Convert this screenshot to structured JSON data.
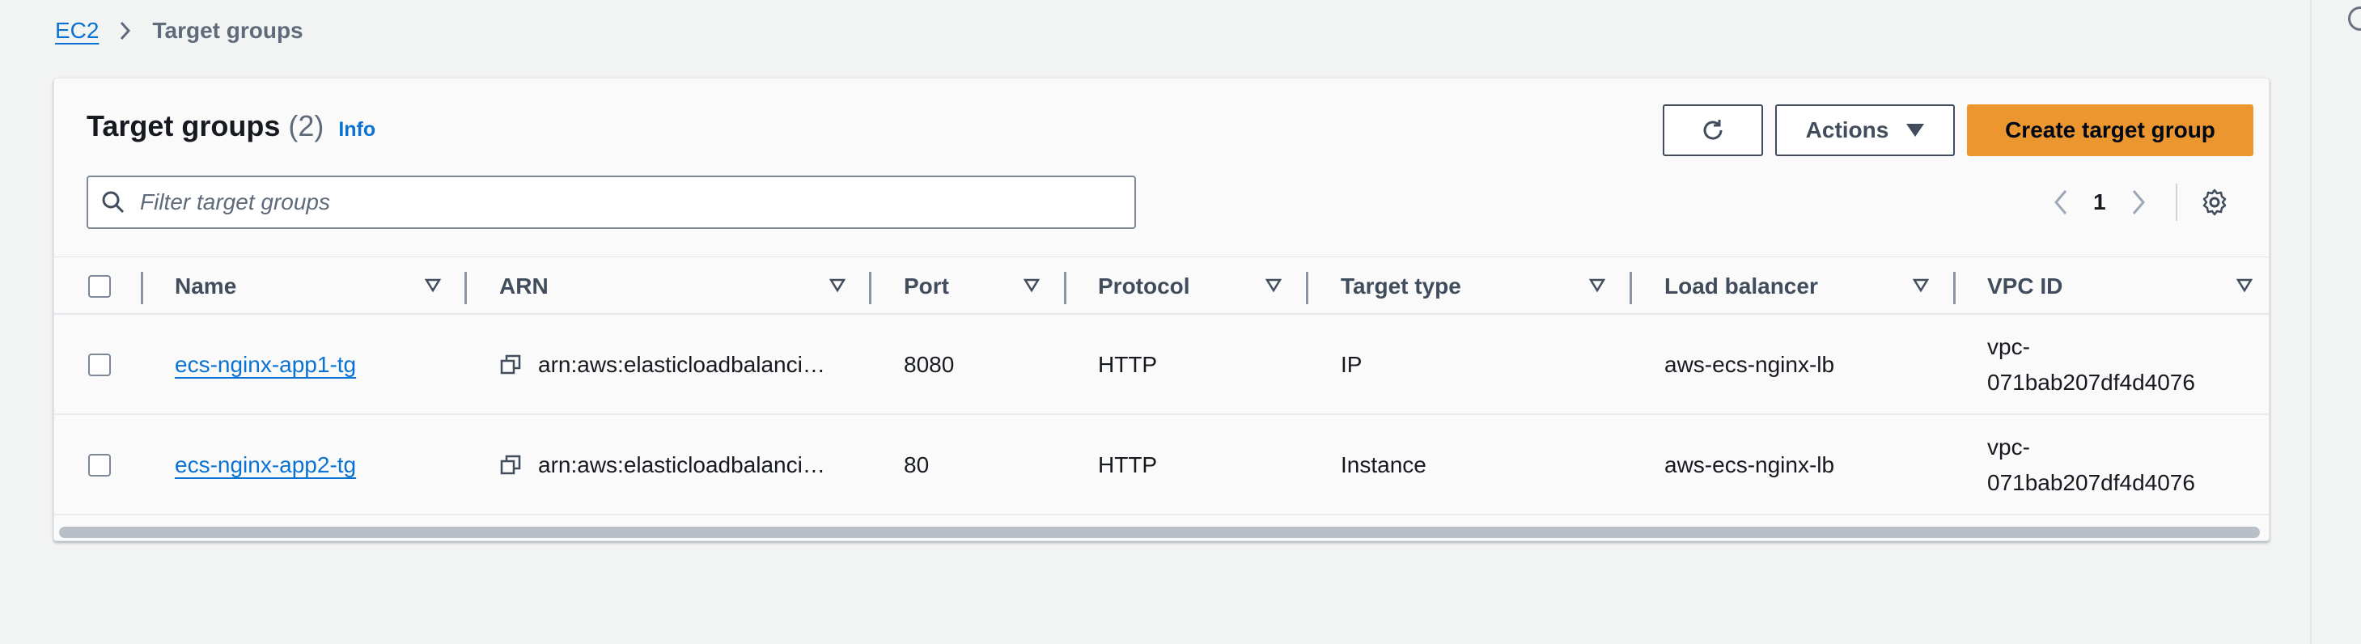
{
  "breadcrumb": {
    "root": "EC2",
    "current": "Target groups"
  },
  "panel": {
    "title": "Target groups",
    "count": "(2)",
    "info": "Info"
  },
  "toolbar": {
    "refresh_icon": "refresh-icon",
    "actions_label": "Actions",
    "create_label": "Create target group"
  },
  "filter": {
    "placeholder": "Filter target groups",
    "value": ""
  },
  "pagination": {
    "page": "1"
  },
  "columns": [
    "Name",
    "ARN",
    "Port",
    "Protocol",
    "Target type",
    "Load balancer",
    "VPC ID"
  ],
  "rows": [
    {
      "name": "ecs-nginx-app1-tg",
      "arn": "arn:aws:elasticloadbalanci…",
      "port": "8080",
      "protocol": "HTTP",
      "target_type": "IP",
      "load_balancer": "aws-ecs-nginx-lb",
      "vpc_line1": "vpc-",
      "vpc_line2": "071bab207df4d4076"
    },
    {
      "name": "ecs-nginx-app2-tg",
      "arn": "arn:aws:elasticloadbalanci…",
      "port": "80",
      "protocol": "HTTP",
      "target_type": "Instance",
      "load_balancer": "aws-ecs-nginx-lb",
      "vpc_line1": "vpc-",
      "vpc_line2": "071bab207df4d4076"
    }
  ],
  "colors": {
    "link": "#0972d3",
    "primary_button": "#ec9630",
    "text": "#16191f"
  }
}
